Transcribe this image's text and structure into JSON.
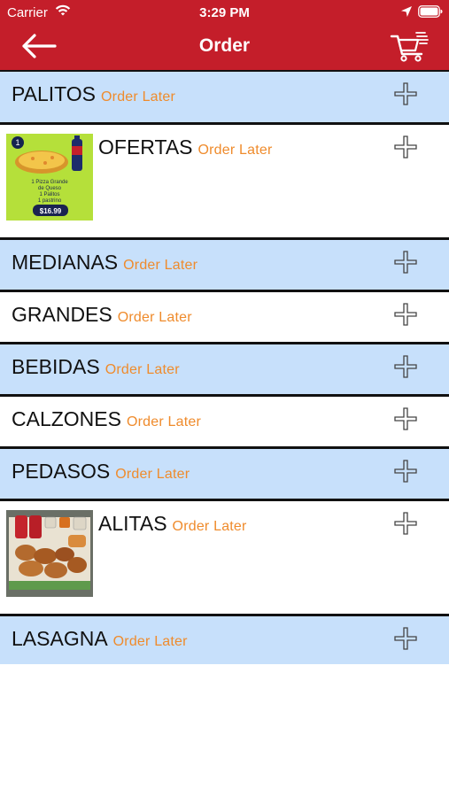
{
  "status_bar": {
    "carrier": "Carrier",
    "time": "3:29 PM"
  },
  "header": {
    "title": "Order",
    "back_icon": "arrow-left-icon",
    "cart_icon": "cart-icon",
    "background_color": "#c41e2a"
  },
  "colors": {
    "row_blue": "#c7e0fb",
    "status_orange": "#ef8b2c",
    "divider": "#111111"
  },
  "menu": {
    "items": [
      {
        "name": "PALITOS",
        "status": "Order Later"
      },
      {
        "name": "OFERTAS",
        "status": "Order Later"
      },
      {
        "name": "MEDIANAS",
        "status": "Order Later"
      },
      {
        "name": "GRANDES",
        "status": "Order Later"
      },
      {
        "name": "BEBIDAS",
        "status": "Order Later"
      },
      {
        "name": "CALZONES",
        "status": "Order Later"
      },
      {
        "name": "PEDASOS",
        "status": "Order Later"
      },
      {
        "name": "ALITAS",
        "status": "Order Later"
      },
      {
        "name": "LASAGNA",
        "status": "Order Later"
      }
    ],
    "add_icon": "plus-icon"
  },
  "ofertas_image": {
    "badge": "1",
    "lines": [
      "1 Pizza Grande",
      "de Queso",
      "1 Palitos",
      "1 pastrino"
    ],
    "price": "$16.99"
  }
}
